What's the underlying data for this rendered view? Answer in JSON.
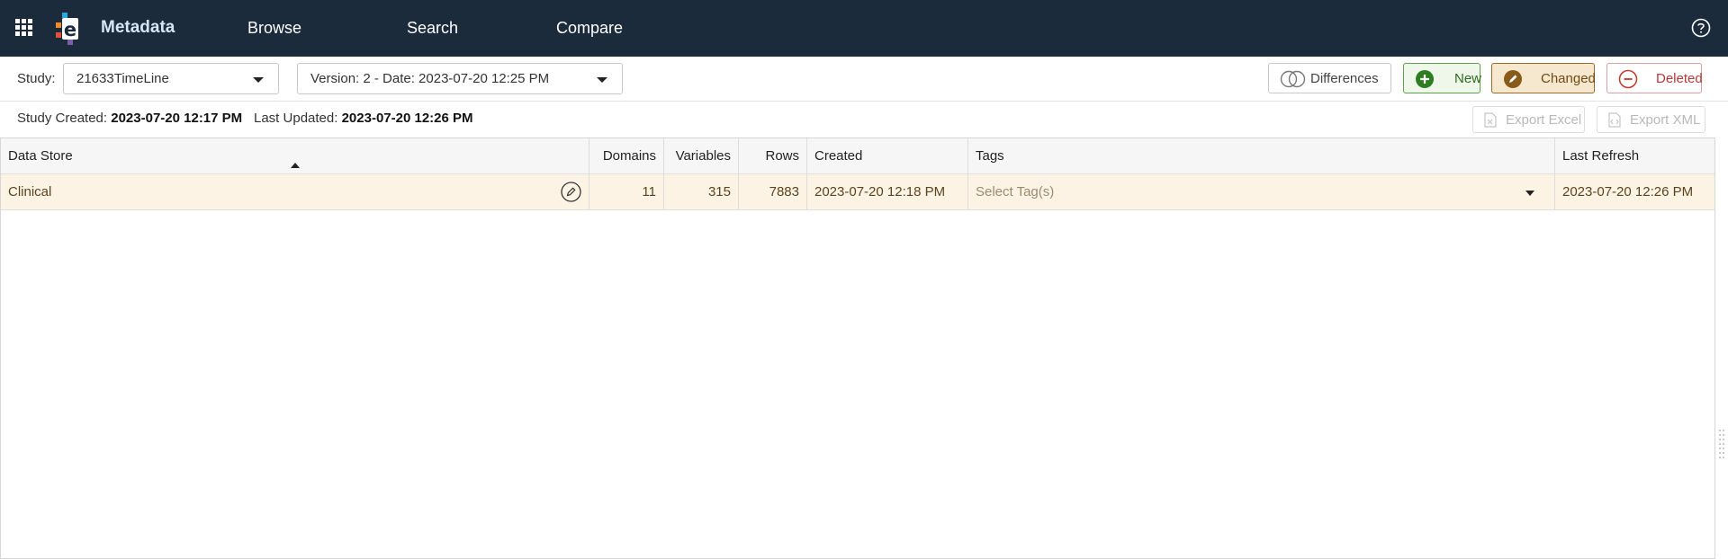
{
  "topbar": {
    "app_name": "Metadata",
    "nav": [
      "Browse",
      "Search",
      "Compare"
    ]
  },
  "toolbar": {
    "study_label": "Study:",
    "study_value": "21633TimeLine",
    "version_value": "Version: 2 - Date: 2023-07-20 12:25 PM",
    "legend": {
      "differences": "Differences",
      "new": "New",
      "changed": "Changed",
      "deleted": "Deleted"
    }
  },
  "info": {
    "created_label": "Study Created:",
    "created_value": "2023-07-20 12:17 PM",
    "updated_label": "Last Updated:",
    "updated_value": "2023-07-20 12:26 PM",
    "export_excel": "Export Excel",
    "export_xml": "Export XML"
  },
  "grid": {
    "columns": [
      "Data Store",
      "Domains",
      "Variables",
      "Rows",
      "Created",
      "Tags",
      "Last Refresh"
    ],
    "rows": [
      {
        "data_store": "Clinical",
        "domains": "11",
        "variables": "315",
        "rows": "7883",
        "created": "2023-07-20 12:18 PM",
        "tags_placeholder": "Select Tag(s)",
        "last_refresh": "2023-07-20 12:26 PM"
      }
    ]
  },
  "colors": {
    "topbar_bg": "#1b2b3c",
    "new_accent": "#2f6b1f",
    "changed_accent": "#8a5a1a",
    "deleted_accent": "#c0392b",
    "changed_row_bg": "#fdf3e5"
  }
}
